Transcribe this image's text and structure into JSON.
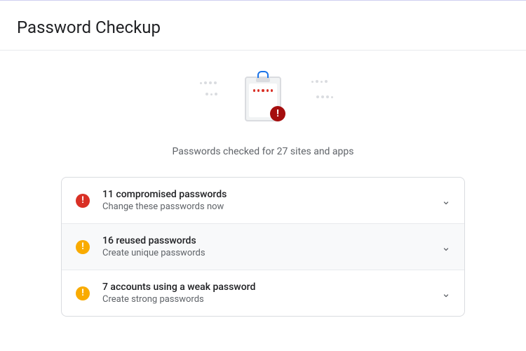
{
  "header": {
    "title": "Password Checkup"
  },
  "summary": {
    "text": "Passwords checked for 27 sites and apps"
  },
  "cards": [
    {
      "title": "11 compromised passwords",
      "subtitle": "Change these passwords now",
      "severity": "red"
    },
    {
      "title": "16 reused passwords",
      "subtitle": "Create unique passwords",
      "severity": "yellow"
    },
    {
      "title": "7 accounts using a weak password",
      "subtitle": "Create strong passwords",
      "severity": "yellow"
    }
  ]
}
